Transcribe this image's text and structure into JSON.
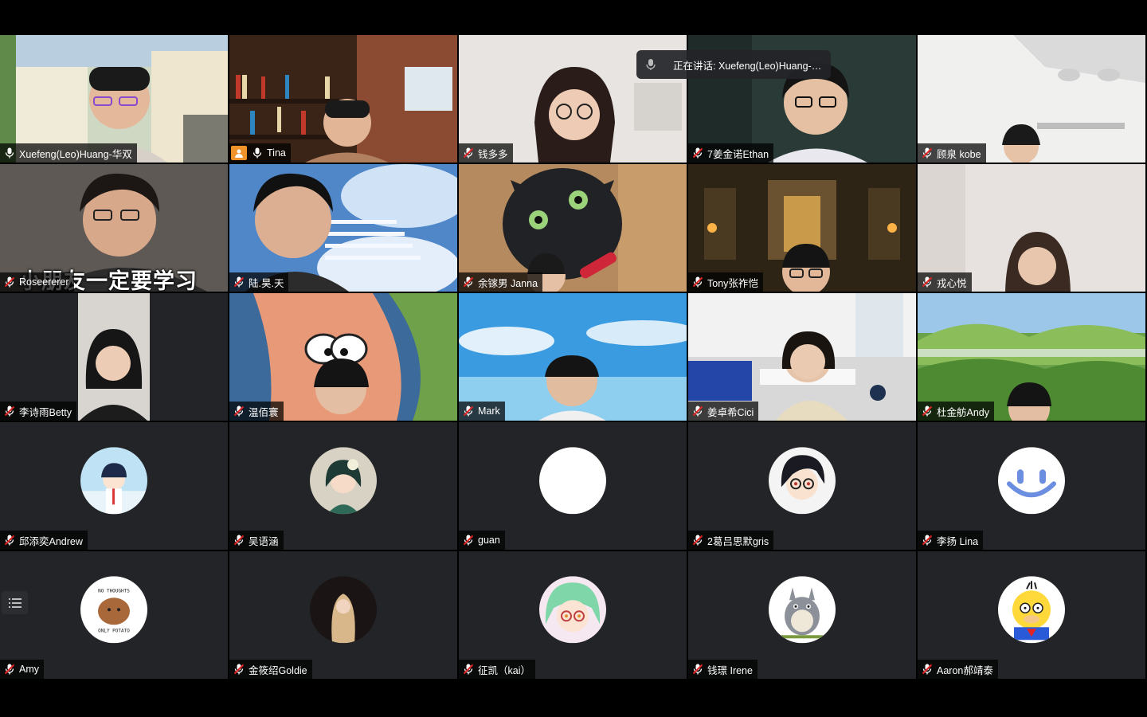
{
  "speaking": {
    "label": "正在讲话: Xuefeng(Leo)Huang-华双"
  },
  "participants": [
    {
      "name": "Xuefeng(Leo)Huang-华双",
      "type": "video",
      "muted": false,
      "active": true
    },
    {
      "name": "Tina",
      "type": "video",
      "muted": false
    },
    {
      "name": "钱多多",
      "type": "video",
      "muted": true
    },
    {
      "name": "7姜金诺Ethan",
      "type": "video",
      "muted": true
    },
    {
      "name": "顾泉 kobe",
      "type": "video",
      "muted": true
    },
    {
      "name": "Roseererer",
      "type": "video",
      "muted": true,
      "caption": "小朋友一定要学习"
    },
    {
      "name": "陆.昊.天",
      "type": "video",
      "muted": true
    },
    {
      "name": "余镓男 Janna",
      "type": "video",
      "muted": true
    },
    {
      "name": "Tony张祚恺",
      "type": "video",
      "muted": true
    },
    {
      "name": "戎心悦",
      "type": "video",
      "muted": true
    },
    {
      "name": "李诗雨Betty",
      "type": "video",
      "muted": true
    },
    {
      "name": "温佰寰",
      "type": "video",
      "muted": true
    },
    {
      "name": "Mark",
      "type": "video",
      "muted": true
    },
    {
      "name": "姜卓希Cici",
      "type": "video",
      "muted": true
    },
    {
      "name": "杜金舫Andy",
      "type": "video",
      "muted": true
    },
    {
      "name": "邱添奕Andrew",
      "type": "avatar",
      "muted": true
    },
    {
      "name": "吴语涵",
      "type": "avatar",
      "muted": true
    },
    {
      "name": "guan",
      "type": "avatar",
      "muted": true
    },
    {
      "name": "2葛吕思默gris",
      "type": "avatar",
      "muted": true
    },
    {
      "name": "李扬 Lina",
      "type": "avatar",
      "muted": true
    },
    {
      "name": "Amy",
      "type": "avatar",
      "muted": true
    },
    {
      "name": "金筱绍Goldie",
      "type": "avatar",
      "muted": true
    },
    {
      "name": "征凯（kai）",
      "type": "avatar",
      "muted": true
    },
    {
      "name": "钱璟 Irene",
      "type": "avatar",
      "muted": true
    },
    {
      "name": "Aaron郝靖泰",
      "type": "avatar",
      "muted": true
    }
  ],
  "avatar_text": {
    "amy_top": "NO THOUGHTS",
    "amy_bottom": "ONLY POTATO"
  },
  "colors": {
    "active_border": "#22c55e",
    "tile_bg": "#232427",
    "name_tag_bg": "rgba(0,0,0,0.72)",
    "muted_slash": "#e02424"
  },
  "icons": {
    "mic": "mic-icon",
    "muted_mic": "mic-off-icon",
    "list": "list-icon"
  }
}
